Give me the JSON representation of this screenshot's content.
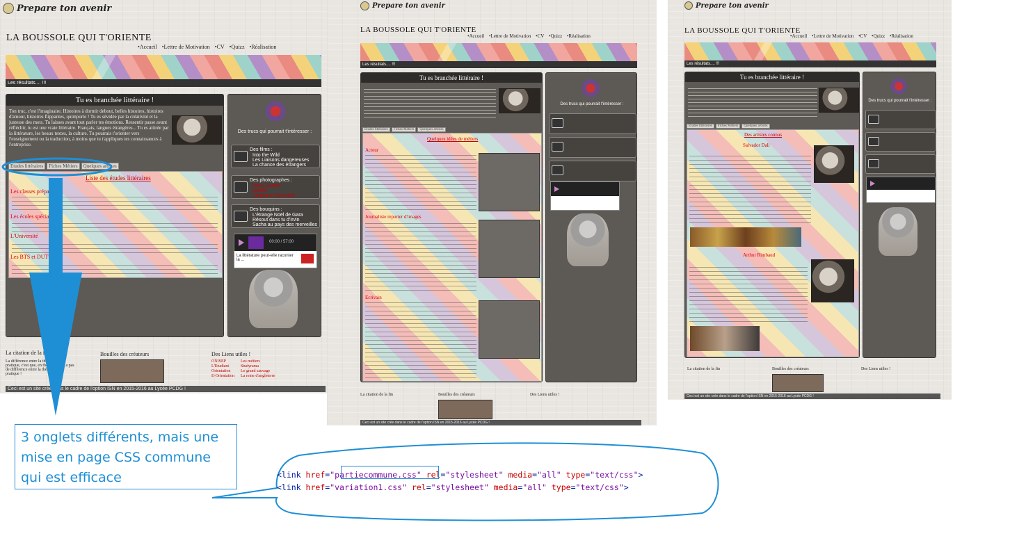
{
  "site": {
    "logo": "Prepare ton avenir",
    "title": "LA BOUSSOLE QUI T'ORIENTE",
    "nav": [
      "•Accueil",
      "•Lettre de Motivation",
      "•CV",
      "•Quizz",
      "•Réalisation"
    ],
    "banner_strip": "Les résultats.... !!!"
  },
  "main": {
    "title": "Tu es branchée littéraire !",
    "intro": "Ton truc, c'est l'imaginaire. Histoires à dormir debout, belles histoires, histoires d'amour, histoires flippantes, quimporte ! Tu es sévidée par la créativité et la justesse des mots. Tu laisses avant tout parler tes émotions. Ressentir passe avant réfléchir, tu est une vraie littéraire. Français, langues étrangères... Tu es attirée par la littérature, les beaux textes, la culture. Tu pourrais t'orienter vers l'enseignement ou la traduction, à moins que tu t'appliques tes connaissances à l'entreprise.",
    "tabs": [
      "Etudes littéraires",
      "Fiches Métiers",
      "Quelques artistes"
    ],
    "tab1_heading": "Liste des études littéraires",
    "tab1_items": [
      "Les classes prépa",
      "Les écoles spécialisées",
      "L'Université",
      "Les BTS et DUT"
    ],
    "tab2_heading": "Quelques idées de métiers",
    "tab2_items": [
      "Acteur",
      "Journaliste reporter d'images",
      "Ecrivain"
    ],
    "tab3_heading": "Des artistes connus",
    "tab3_items": [
      "Salvador Dali",
      "Arthur Rimbaud"
    ]
  },
  "sidebar": {
    "title": "Des trucs qui pourrait t'intéresser :",
    "films_title": "Des films :",
    "films": [
      "Into the Wild",
      "Les Liaisons dangereuses",
      "La chance des étrangers"
    ],
    "photos_title": "Des photographes :",
    "photos": [
      "Henri Cartier",
      "Larelle",
      "Stéphane Duroselle"
    ],
    "books_title": "Des bouquins :",
    "books": [
      "L'étrange Noël de Gara",
      "Résout dans tu d'Irvin",
      "Sacha au pays des merveilles"
    ],
    "player_caption": "La littérature peut-elle raconter la ...",
    "player_time": "00:00 / 57:00"
  },
  "footer": {
    "quote_title": "La citation de la fin",
    "quote_text": "La différence entre la théorie et la pratique, c'est que, en théorie, il n'y a pas de différence entre la théorie et la pratique !",
    "creators_title": "Bouilles des créateurs",
    "links_title": "Des Liens utiles !",
    "links": [
      "ONISEP",
      "L'Etudiant",
      "Orientation",
      "E-Orientation",
      "Les métiers",
      "Studyrama",
      "Le grand sauvage",
      "La reine d'angleterre"
    ],
    "bar": "Ceci est un site crée dans le cadre de l'option ISN en 2015-2016 au Lycée PCDG !"
  },
  "annotation": {
    "callout": "3 onglets différents, mais une mise en page CSS commune qui est efficace",
    "link1_href": "partiecommune.css",
    "link2_href": "variation1.css",
    "rel": "stylesheet",
    "media": "all",
    "type": "text/css"
  },
  "colors": {
    "arrow": "#1e8fd5",
    "panel": "#5d5954",
    "accent_red": "#cc0000"
  }
}
